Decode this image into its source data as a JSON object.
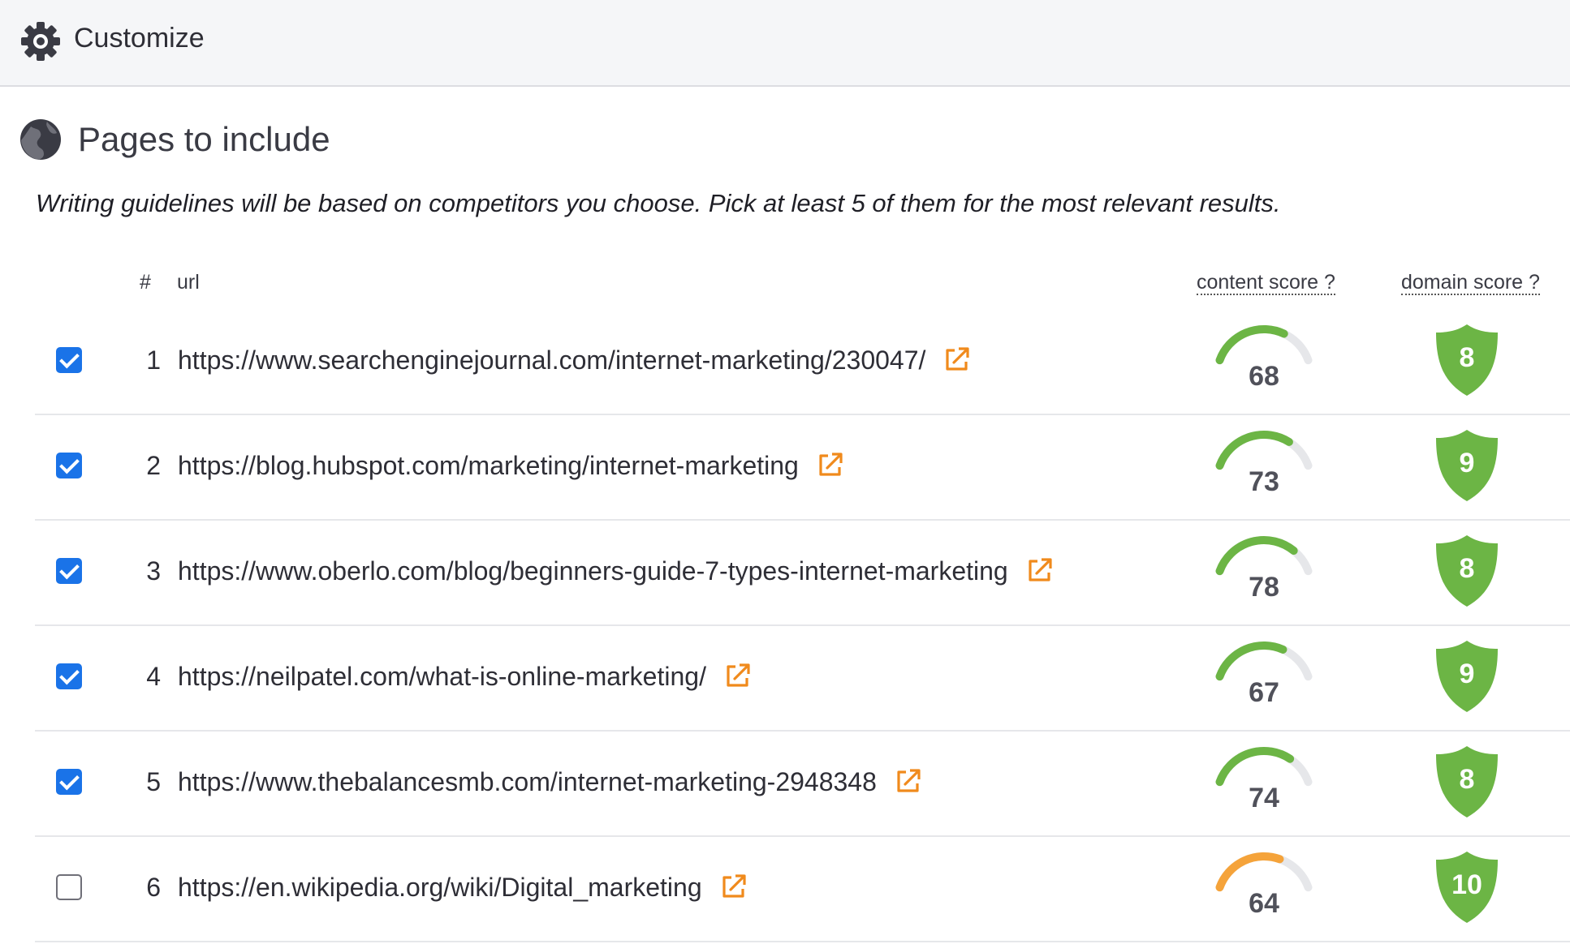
{
  "header": {
    "title": "Customize",
    "icon": "gear-icon"
  },
  "section": {
    "title": "Pages to include",
    "icon": "globe-icon",
    "subtitle": "Writing guidelines will be based on competitors you choose. Pick at least 5 of them for the most relevant results."
  },
  "table": {
    "headers": {
      "number": "#",
      "url": "url",
      "content_score": "content score ?",
      "domain_score": "domain score ?"
    },
    "rows": [
      {
        "checked": true,
        "number": "1",
        "url": "https://www.searchenginejournal.com/internet-marketing/230047/",
        "content_score": "68",
        "content_fraction": 0.68,
        "domain_score": "8"
      },
      {
        "checked": true,
        "number": "2",
        "url": "https://blog.hubspot.com/marketing/internet-marketing",
        "content_score": "73",
        "content_fraction": 0.73,
        "domain_score": "9"
      },
      {
        "checked": true,
        "number": "3",
        "url": "https://www.oberlo.com/blog/beginners-guide-7-types-internet-marketing",
        "content_score": "78",
        "content_fraction": 0.78,
        "domain_score": "8"
      },
      {
        "checked": true,
        "number": "4",
        "url": "https://neilpatel.com/what-is-online-marketing/",
        "content_score": "67",
        "content_fraction": 0.67,
        "domain_score": "9"
      },
      {
        "checked": true,
        "number": "5",
        "url": "https://www.thebalancesmb.com/internet-marketing-2948348",
        "content_score": "74",
        "content_fraction": 0.74,
        "domain_score": "8"
      },
      {
        "checked": false,
        "number": "6",
        "url": "https://en.wikipedia.org/wiki/Digital_marketing",
        "content_score": "64",
        "content_fraction": 0.64,
        "domain_score": "10"
      }
    ]
  },
  "colors": {
    "checkbox": "#1a73e8",
    "link_icon": "#f08a1c",
    "gauge_green": "#6cb545",
    "gauge_orange": "#f5a33a",
    "gauge_track": "#e6e7ea",
    "shield_green": "#6cb545"
  }
}
